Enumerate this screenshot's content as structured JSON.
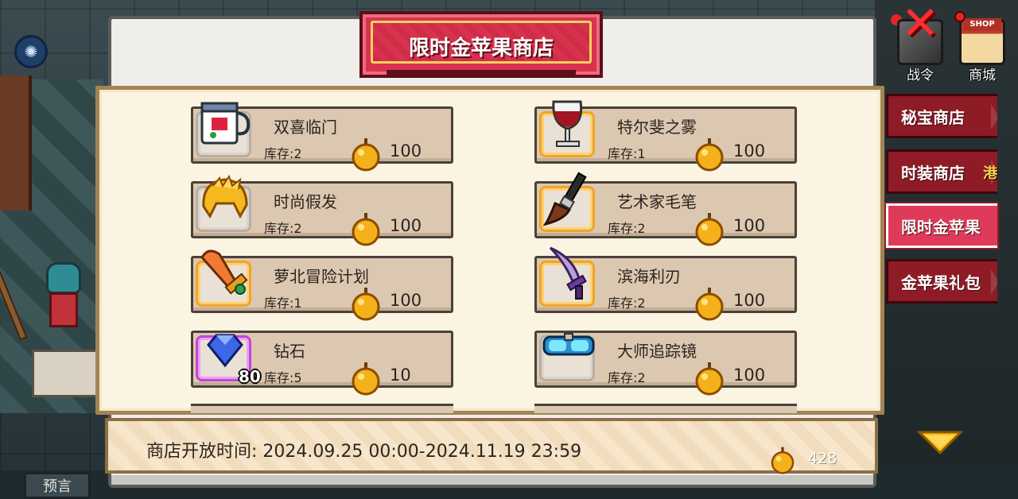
{
  "shop": {
    "title": "限时金苹果商店",
    "open_time_label": "商店开放时间:",
    "open_time_value": "2024.09.25 00:00-2024.11.19 23:59",
    "currency_icon": "golden-apple-icon",
    "balance": "428"
  },
  "items_left": [
    {
      "name": "双喜临门",
      "stock": "库存:2",
      "price": "100",
      "icon": "mug-icon",
      "rarity": "grey"
    },
    {
      "name": "时尚假发",
      "stock": "库存:2",
      "price": "100",
      "icon": "golden-wig-icon",
      "rarity": "grey"
    },
    {
      "name": "萝北冒险计划",
      "stock": "库存:1",
      "price": "100",
      "icon": "carrot-sword-icon",
      "rarity": "gold"
    },
    {
      "name": "钻石",
      "stock": "库存:5",
      "price": "10",
      "icon": "diamond-icon",
      "rarity": "purple",
      "quantity": "80"
    }
  ],
  "items_right": [
    {
      "name": "特尔斐之雾",
      "stock": "库存:1",
      "price": "100",
      "icon": "wine-glass-icon",
      "rarity": "gold"
    },
    {
      "name": "艺术家毛笔",
      "stock": "库存:2",
      "price": "100",
      "icon": "paintbrush-icon",
      "rarity": "gold"
    },
    {
      "name": "滨海利刃",
      "stock": "库存:2",
      "price": "100",
      "icon": "purple-blade-icon",
      "rarity": "gold"
    },
    {
      "name": "大师追踪镜",
      "stock": "库存:2",
      "price": "100",
      "icon": "goggles-icon",
      "rarity": "grey"
    }
  ],
  "side_tabs": [
    {
      "label": "秘宝商店",
      "active": false
    },
    {
      "label": "时装商店",
      "active": false
    },
    {
      "label": "限时金苹果",
      "active": true
    },
    {
      "label": "金苹果礼包",
      "active": false
    }
  ],
  "top_icons": {
    "battle_pass": "战令",
    "mall": "商城",
    "shop_sign": "SHOP"
  },
  "bottom_left": {
    "predict": "预言"
  },
  "side_partial_text": "港",
  "colors": {
    "tab_inactive": "#8e1b26",
    "tab_active": "#e03a5a",
    "banner": "#d7334e",
    "card_bg": "#dcc7b0",
    "gold_border": "#f0a42a",
    "purple_border": "#c544d8"
  }
}
